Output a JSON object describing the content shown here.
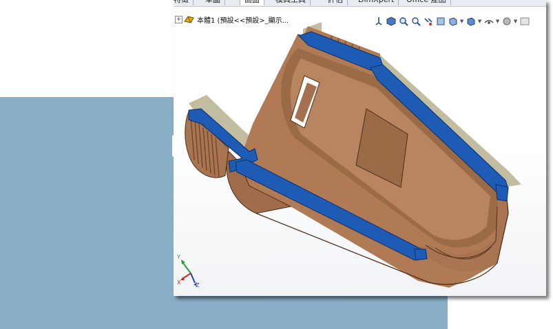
{
  "tabs": [
    {
      "label": "特徵",
      "active": false
    },
    {
      "label": "草圖",
      "active": false
    },
    {
      "label": "曲面",
      "active": true
    },
    {
      "label": "模具工具",
      "active": false
    },
    {
      "label": "評估",
      "active": false
    },
    {
      "label": "DimXpert",
      "active": false
    },
    {
      "label": "Office 產品",
      "active": false
    }
  ],
  "tree": {
    "root_label": "本體1  (預設<<預設>_顯示..."
  },
  "toolbar_icons": [
    "view-orientation-icon",
    "view-3d-icon",
    "zoom-to-fit-icon",
    "zoom-area-icon",
    "previous-view-icon",
    "section-view-icon",
    "view-orientation-icon",
    "display-style-icon",
    "hide-show-items-icon",
    "edit-appearance-icon",
    "apply-scene-icon"
  ],
  "colors": {
    "background_panel": "#89aec8",
    "part_bronze": "#b07a55",
    "section_face": "#1d5bb5",
    "section_shadow": "#b7b28f"
  },
  "triad_axes": [
    "Y",
    "X",
    "Z"
  ]
}
